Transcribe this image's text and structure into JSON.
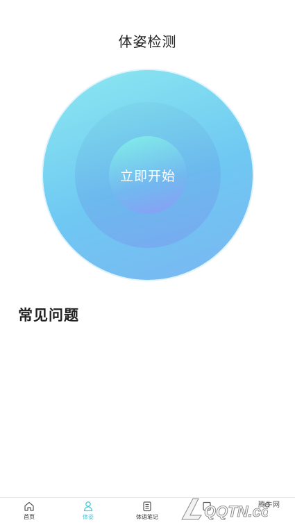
{
  "header": {
    "title": "体姿检测"
  },
  "detect": {
    "start_label": "立即开始"
  },
  "faq": {
    "title": "常见问题"
  },
  "tabs": [
    {
      "label": "首页",
      "icon": "home-icon",
      "active": false
    },
    {
      "label": "体姿",
      "icon": "posture-icon",
      "active": true
    },
    {
      "label": "体语笔记",
      "icon": "notes-icon",
      "active": false
    },
    {
      "label": "",
      "icon": "tab-icon",
      "active": false
    },
    {
      "label": "",
      "icon": "tab-icon",
      "active": false
    }
  ],
  "watermark": {
    "site": "腾牛网",
    "logo_text": "QQTN.com"
  },
  "colors": {
    "accent": "#4fc6d8",
    "ring_outer": "#8ce9f0",
    "ring_inner": "#72b8f0",
    "button_gradient_end": "#8a9cf5"
  }
}
